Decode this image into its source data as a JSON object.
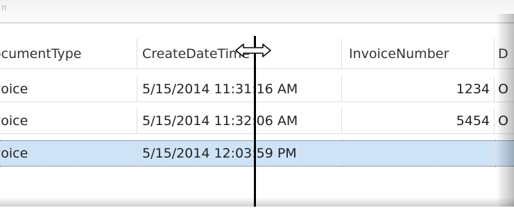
{
  "title_fragment": "n",
  "grid": {
    "columns": [
      "ocumentType",
      "CreateDateTime",
      "InvoiceNumber",
      "D"
    ],
    "rows": [
      {
        "type": "voice",
        "created": "5/15/2014 11:31:16 AM",
        "invoice": "1234",
        "extra": "O"
      },
      {
        "type": "voice",
        "created": "5/15/2014 11:32:06 AM",
        "invoice": "5454",
        "extra": "O"
      },
      {
        "type": "voice",
        "created": "5/15/2014 12:03:59 PM",
        "invoice": "",
        "extra": ""
      }
    ],
    "selected_row": 2,
    "selection_color": "#cfe3f7"
  },
  "cursor": {
    "icon": "column-resize-icon"
  }
}
